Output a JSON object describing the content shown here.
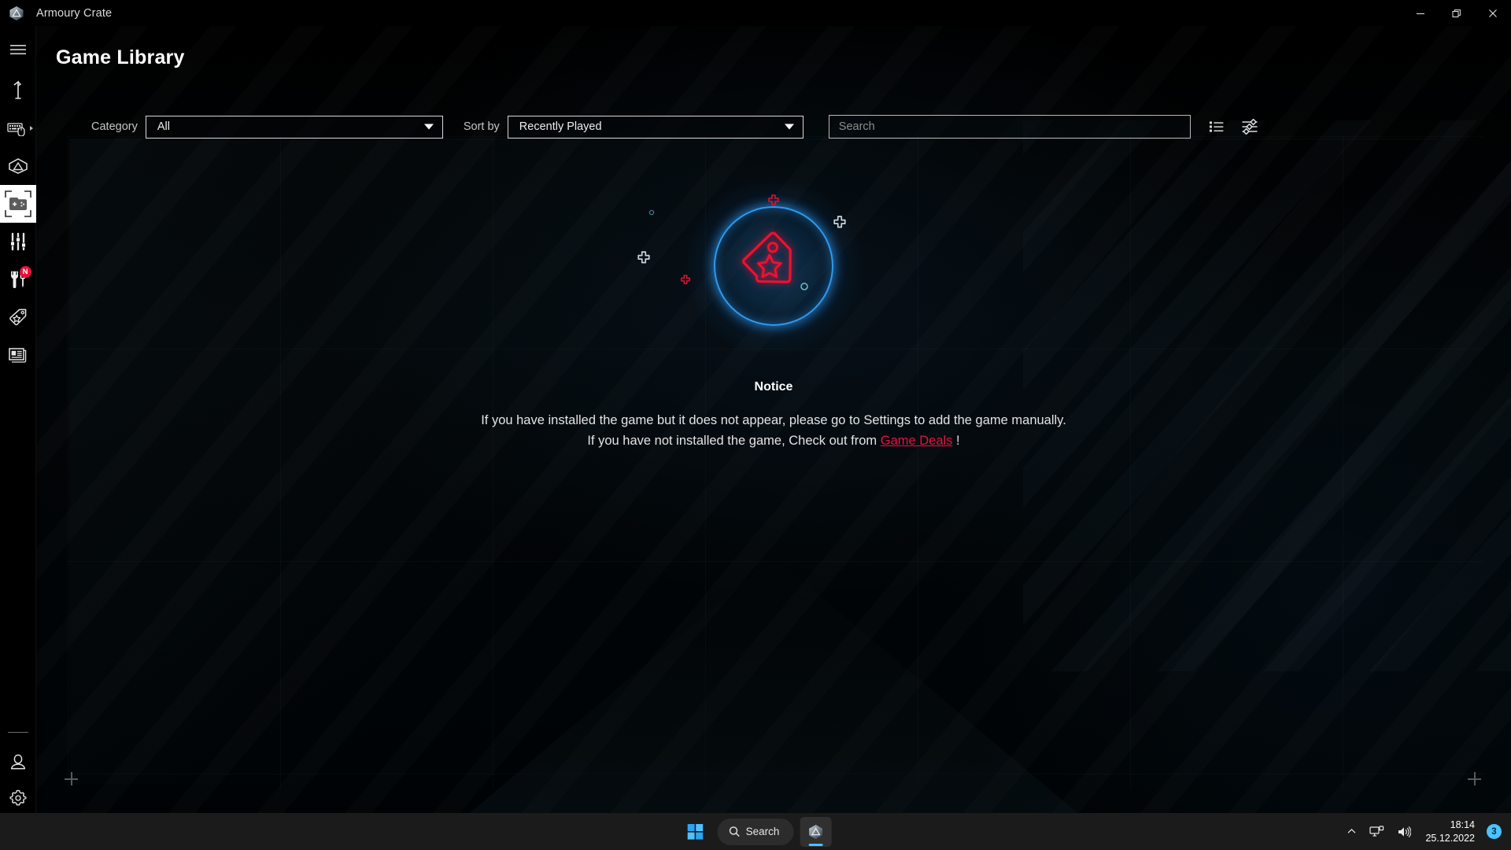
{
  "window": {
    "app_title": "Armoury Crate",
    "logo_icon": "armoury-crate-logo",
    "controls": {
      "minimize_icon": "minimize-icon",
      "restore_icon": "restore-icon",
      "close_icon": "close-icon"
    }
  },
  "sidebar": {
    "menu_icon": "hamburger-menu-icon",
    "items": [
      {
        "name": "device-info",
        "icon": "device-info-icon",
        "label": "Device",
        "active": false,
        "arrow": false,
        "badge": null
      },
      {
        "name": "keyboard-mouse",
        "icon": "keyboard-mouse-icon",
        "label": "Devices",
        "active": false,
        "arrow": true,
        "badge": null
      },
      {
        "name": "aura-sync",
        "icon": "aura-sync-icon",
        "label": "Aura Sync",
        "active": false,
        "arrow": false,
        "badge": null
      },
      {
        "name": "game-library",
        "icon": "game-library-icon",
        "label": "Game Library",
        "active": true,
        "arrow": false,
        "badge": null
      },
      {
        "name": "scenario-profiles",
        "icon": "sliders-icon",
        "label": "Scenario Profiles",
        "active": false,
        "arrow": false,
        "badge": null
      },
      {
        "name": "tools",
        "icon": "wrench-screwdriver-icon",
        "label": "Tools",
        "active": false,
        "arrow": false,
        "badge": "N"
      },
      {
        "name": "game-deals",
        "icon": "price-tag-icon",
        "label": "Game Deals",
        "active": false,
        "arrow": false,
        "badge": null
      },
      {
        "name": "news",
        "icon": "news-icon",
        "label": "News",
        "active": false,
        "arrow": false,
        "badge": null
      }
    ],
    "bottom_items": [
      {
        "name": "user-profile",
        "icon": "user-avatar-icon",
        "label": "User Center"
      },
      {
        "name": "settings",
        "icon": "gear-icon",
        "label": "Settings"
      }
    ]
  },
  "header": {
    "page_title": "Game Library"
  },
  "toolbar": {
    "category_label": "Category",
    "category_value": "All",
    "category_options": [
      "All"
    ],
    "sort_label": "Sort by",
    "sort_value": "Recently Played",
    "sort_options": [
      "Recently Played"
    ],
    "search_placeholder": "Search",
    "search_value": "",
    "list_view_icon": "list-view-icon",
    "filter_icon": "filter-sliders-icon"
  },
  "empty_state": {
    "art_icon": "price-tag-star-icon",
    "notice_heading": "Notice",
    "line1": "If you have installed the game but it does not appear, please go to Settings to add the game manually.",
    "line2_before": "If you have not installed the game, Check out from",
    "link_text": "Game Deals",
    "line2_after": "!"
  },
  "colors": {
    "accent_red": "#e8113c",
    "accent_blue": "#2f9bf0",
    "taskbar_blue": "#4cc2ff",
    "background": "#000000",
    "text_primary": "#ffffff",
    "text_secondary": "#c6c6c6"
  },
  "taskbar": {
    "start_icon": "windows-start-icon",
    "search_icon": "search-icon",
    "search_label": "Search",
    "app_icon": "armoury-crate-taskbar-icon",
    "chevron_icon": "chevron-up-icon",
    "network_icon": "network-icon",
    "volume_icon": "volume-icon",
    "time": "18:14",
    "date": "25.12.2022",
    "notification_count": "3"
  }
}
